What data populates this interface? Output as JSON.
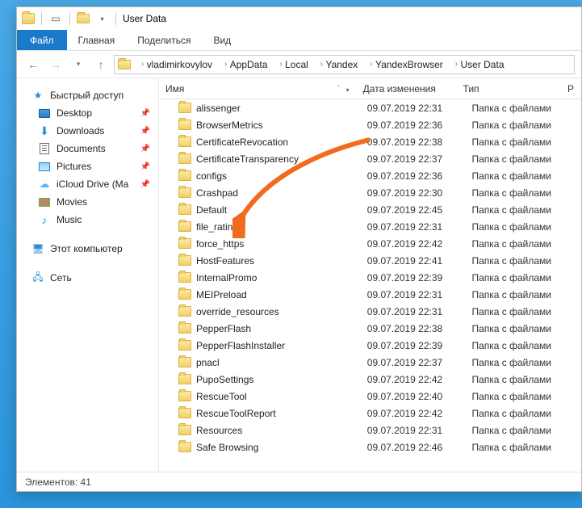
{
  "window": {
    "title": "User Data"
  },
  "menu": {
    "file": "Файл",
    "items": [
      "Главная",
      "Поделиться",
      "Вид"
    ]
  },
  "breadcrumb": {
    "segments": [
      "vladimirkovylov",
      "AppData",
      "Local",
      "Yandex",
      "YandexBrowser",
      "User Data"
    ]
  },
  "sidebar": {
    "quick_access": {
      "label": "Быстрый доступ",
      "items": [
        {
          "label": "Desktop",
          "icon": "desktop-icon",
          "pinned": true
        },
        {
          "label": "Downloads",
          "icon": "download-icon",
          "pinned": true
        },
        {
          "label": "Documents",
          "icon": "document-icon",
          "pinned": true
        },
        {
          "label": "Pictures",
          "icon": "picture-icon",
          "pinned": true
        },
        {
          "label": "iCloud Drive (Ma",
          "icon": "cloud-icon",
          "pinned": true
        },
        {
          "label": "Movies",
          "icon": "film-icon",
          "pinned": false
        },
        {
          "label": "Music",
          "icon": "music-icon",
          "pinned": false
        }
      ]
    },
    "this_pc": {
      "label": "Этот компьютер"
    },
    "network": {
      "label": "Сеть"
    }
  },
  "columns": {
    "name": "Имя",
    "date": "Дата изменения",
    "type": "Тип",
    "size": "Р"
  },
  "type_folder": "Папка с файлами",
  "files": [
    {
      "name": "alissenger",
      "date": "09.07.2019 22:31"
    },
    {
      "name": "BrowserMetrics",
      "date": "09.07.2019 22:36"
    },
    {
      "name": "CertificateRevocation",
      "date": "09.07.2019 22:38"
    },
    {
      "name": "CertificateTransparency",
      "date": "09.07.2019 22:37"
    },
    {
      "name": "configs",
      "date": "09.07.2019 22:36"
    },
    {
      "name": "Crashpad",
      "date": "09.07.2019 22:30"
    },
    {
      "name": "Default",
      "date": "09.07.2019 22:45"
    },
    {
      "name": "file_rating",
      "date": "09.07.2019 22:31"
    },
    {
      "name": "force_https",
      "date": "09.07.2019 22:42"
    },
    {
      "name": "HostFeatures",
      "date": "09.07.2019 22:41"
    },
    {
      "name": "InternalPromo",
      "date": "09.07.2019 22:39"
    },
    {
      "name": "MEIPreload",
      "date": "09.07.2019 22:31"
    },
    {
      "name": "override_resources",
      "date": "09.07.2019 22:31"
    },
    {
      "name": "PepperFlash",
      "date": "09.07.2019 22:38"
    },
    {
      "name": "PepperFlashInstaller",
      "date": "09.07.2019 22:39"
    },
    {
      "name": "pnacl",
      "date": "09.07.2019 22:37"
    },
    {
      "name": "PupoSettings",
      "date": "09.07.2019 22:42"
    },
    {
      "name": "RescueTool",
      "date": "09.07.2019 22:40"
    },
    {
      "name": "RescueToolReport",
      "date": "09.07.2019 22:42"
    },
    {
      "name": "Resources",
      "date": "09.07.2019 22:31"
    },
    {
      "name": "Safe Browsing",
      "date": "09.07.2019 22:46"
    }
  ],
  "status": {
    "label": "Элементов:",
    "count": "41"
  },
  "annotation": {
    "target_index": 6
  }
}
